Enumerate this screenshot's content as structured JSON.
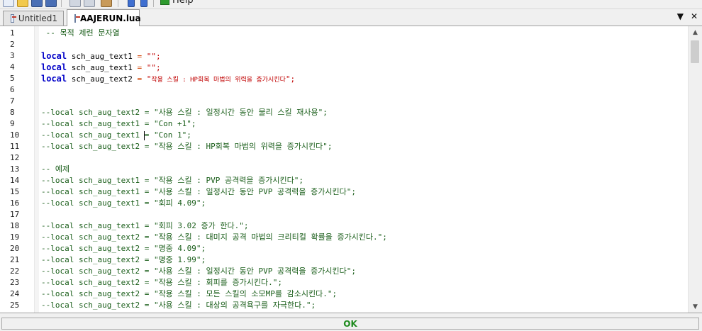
{
  "toolbar": {
    "help_label": "Help",
    "icons": [
      "new-file-icon",
      "open-folder-icon",
      "save-icon",
      "save-all-icon",
      "cut-icon",
      "copy-icon",
      "paste-icon",
      "undo-icon",
      "redo-icon",
      "help-icon"
    ]
  },
  "tabs": [
    {
      "label": "Untitled1",
      "active": false
    },
    {
      "label": "AAJERUN.lua",
      "active": true
    }
  ],
  "tabbar_controls": {
    "dropdown": "▼",
    "close": "✕"
  },
  "editor": {
    "lines": [
      {
        "no": "1"
      },
      {
        "no": "2"
      },
      {
        "no": "3"
      },
      {
        "no": "4"
      },
      {
        "no": "5"
      },
      {
        "no": "6"
      },
      {
        "no": "7"
      },
      {
        "no": "8"
      },
      {
        "no": "9"
      },
      {
        "no": "10"
      },
      {
        "no": "11"
      },
      {
        "no": "12"
      },
      {
        "no": "13"
      },
      {
        "no": "14"
      },
      {
        "no": "15"
      },
      {
        "no": "16"
      },
      {
        "no": "17"
      },
      {
        "no": "18"
      },
      {
        "no": "19"
      },
      {
        "no": "20"
      },
      {
        "no": "21"
      },
      {
        "no": "22"
      },
      {
        "no": "23"
      },
      {
        "no": "24"
      },
      {
        "no": "25"
      }
    ],
    "code": {
      "l1": " -- 목적 제련 문자열",
      "l3_kw": "local",
      "l3_var": " sch_aug_text1 ",
      "l3_eq": "=",
      "l3_str": " \"\";",
      "l4_kw": "local",
      "l4_var": " sch_aug_text1 ",
      "l4_eq": "=",
      "l4_str": " \"\";",
      "l5_kw": "local",
      "l5_var": " sch_aug_text2 ",
      "l5_eq": "=",
      "l5_q1": " \"",
      "l5_str": "작용 스킬 : HP회복 마법의 위력을 증가시킨다",
      "l5_q2": "\";",
      "l8": "--local sch_aug_text2 = \"사용 스킬 : 일정시간 동안 물리 스킬 재사용\";",
      "l9": "--local sch_aug_text1 = \"Con +1\";",
      "l10": "--local sch_aug_text1 = \"Con 1\";",
      "l11": "--local sch_aug_text2 = \"작용 스킬 : HP회복 마법의 위력을 증가시킨다\";",
      "l13": "-- 예제",
      "l14": "--local sch_aug_text1 = \"작용 스킬 : PVP 공격력을 증가시킨다\";",
      "l15": "--local sch_aug_text1 = \"사용 스킬 : 일정시간 동안 PVP 공격력을 증가시킨다\";",
      "l16": "--local sch_aug_text1 = \"회피 4.09\";",
      "l18": "--local sch_aug_text1 = \"회피 3.02 증가 한다.\";",
      "l19": "--local sch_aug_text2 = \"작용 스킬 : 대미지 공격 마법의 크리티컬 확률을 증가시킨다.\";",
      "l20": "--local sch_aug_text2 = \"명중 4.09\";",
      "l21": "--local sch_aug_text2 = \"명중 1.99\";",
      "l22": "--local sch_aug_text2 = \"사용 스킬 : 일정시간 동안 PVP 공격력을 증가시킨다\";",
      "l23": "--local sch_aug_text2 = \"작용 스킬 : 회피를 증가시킨다.\";",
      "l24": "--local sch_aug_text2 = \"작용 스킬 : 모든 스킬의 소모MP를 감소시킨다.\";",
      "l25": "--local sch_aug_text2 = \"사용 스킬 : 대상의 공격욕구를 자극한다.\";"
    }
  },
  "colors": {
    "keyword": "#0000c8",
    "string": "#c00000",
    "comment": "#1a5e1a",
    "status_ok": "#1c8a1c"
  },
  "status": {
    "text": "OK"
  }
}
